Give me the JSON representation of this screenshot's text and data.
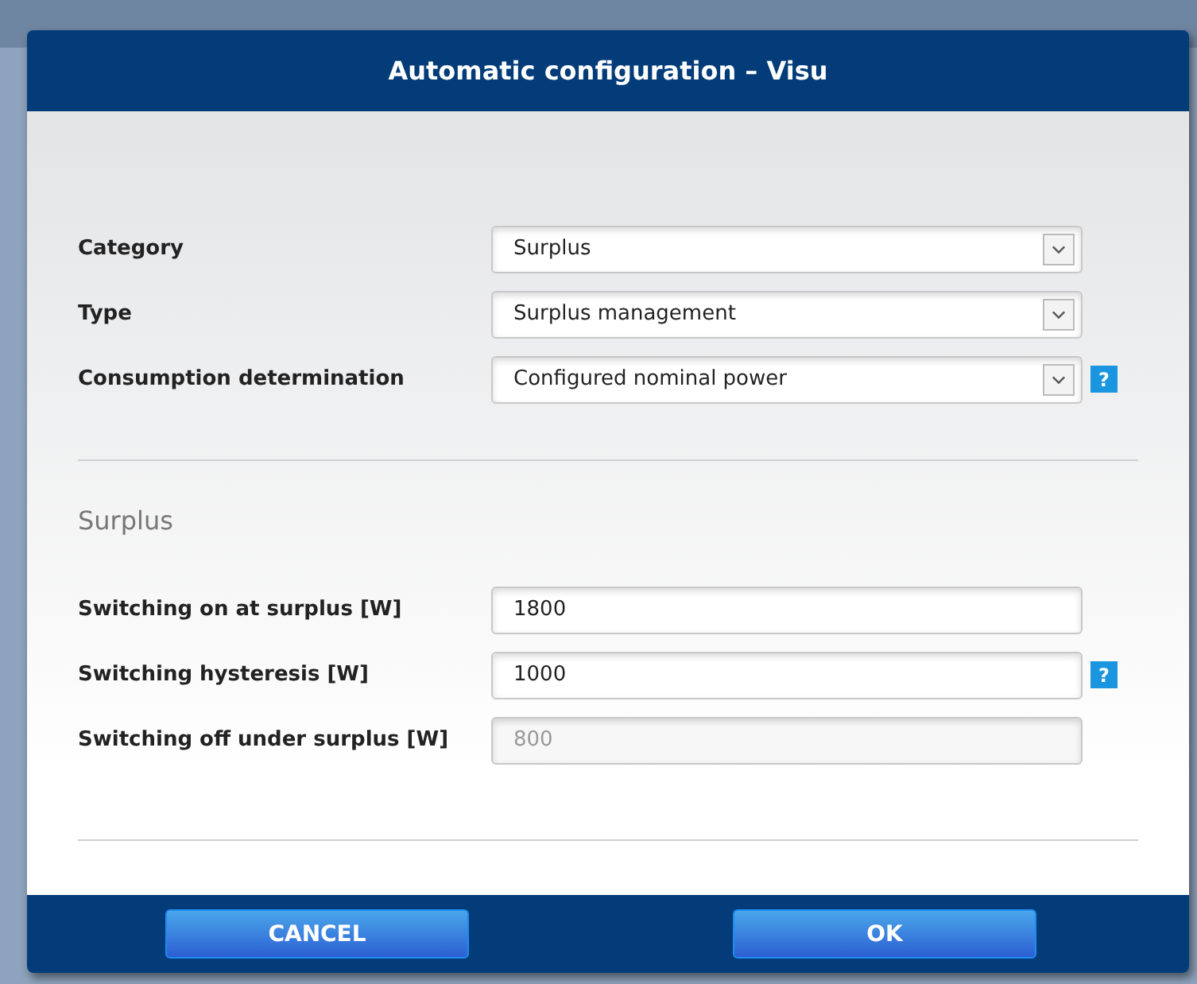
{
  "dialog": {
    "title": "Automatic configuration – Visu"
  },
  "general_fields": [
    {
      "label": "Category",
      "kind": "select",
      "value": "Surplus",
      "disabled": false
    },
    {
      "label": "Type",
      "kind": "select",
      "value": "Surplus management",
      "disabled": false
    },
    {
      "label": "Consumption determination",
      "kind": "select",
      "value": "Configured nominal power",
      "help": "?",
      "disabled": false
    }
  ],
  "section": {
    "heading": "Surplus"
  },
  "surplus_fields": [
    {
      "label": "Switching on at surplus [W]",
      "kind": "input",
      "value": "1800",
      "disabled": false
    },
    {
      "label": "Switching hysteresis [W]",
      "kind": "input",
      "value": "1000",
      "help": "?",
      "disabled": false
    },
    {
      "label": "Switching off under surplus [W]",
      "kind": "input",
      "value": "800",
      "disabled": true
    }
  ],
  "buttons": [
    {
      "label": "CANCEL"
    },
    {
      "label": "OK"
    }
  ]
}
